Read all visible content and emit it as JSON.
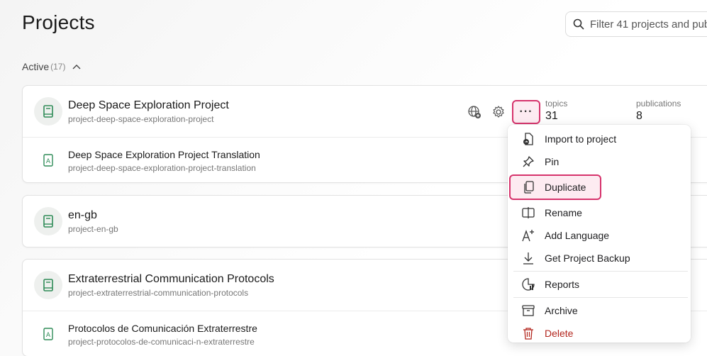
{
  "header": {
    "title": "Projects",
    "filter_placeholder": "Filter 41 projects and pub"
  },
  "section": {
    "label": "Active",
    "count": "(17)"
  },
  "projects": [
    {
      "name": "Deep Space Exploration Project",
      "slug": "project-deep-space-exploration-project",
      "topics_label": "topics",
      "topics_value": "31",
      "publications_label": "publications",
      "publications_value": "8",
      "translation": {
        "name": "Deep Space Exploration Project Translation",
        "slug": "project-deep-space-exploration-project-translation"
      }
    },
    {
      "name": "en-gb",
      "slug": "project-en-gb"
    },
    {
      "name": "Extraterrestrial Communication Protocols",
      "slug": "project-extraterrestrial-communication-protocols",
      "translation": {
        "name": "Protocolos de Comunicación Extraterrestre",
        "slug": "project-protocolos-de-comunicaci-n-extraterrestre"
      }
    }
  ],
  "menu": {
    "items": [
      {
        "label": "Import to project",
        "icon": "import-icon"
      },
      {
        "label": "Pin",
        "icon": "pin-icon"
      },
      {
        "label": "Duplicate",
        "icon": "duplicate-icon"
      },
      {
        "label": "Rename",
        "icon": "rename-icon"
      },
      {
        "label": "Add Language",
        "icon": "add-language-icon"
      },
      {
        "label": "Get Project Backup",
        "icon": "download-icon"
      },
      {
        "label": "Reports",
        "icon": "reports-icon"
      },
      {
        "label": "Archive",
        "icon": "archive-icon"
      },
      {
        "label": "Delete",
        "icon": "trash-icon"
      }
    ]
  },
  "more_label": "···",
  "colors": {
    "accent": "#d6336c",
    "accent_bg": "#fdebf1",
    "project_icon": "#2e8b57",
    "danger": "#b3261e"
  }
}
